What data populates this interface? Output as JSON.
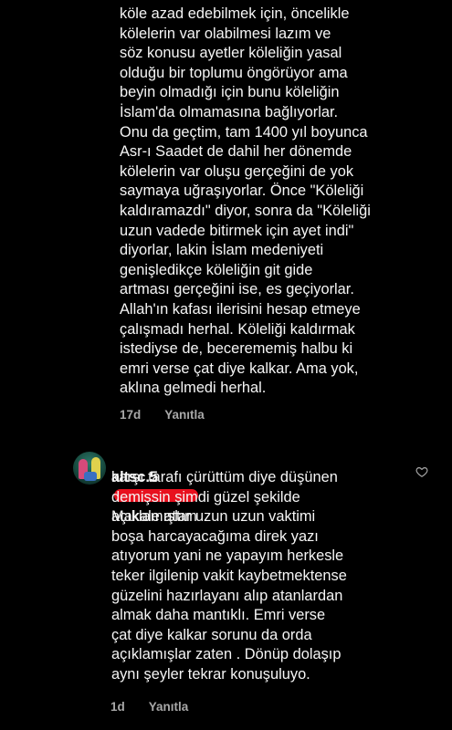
{
  "thread": {
    "first_comment": {
      "text": "köle azad edebilmek için, öncelikle\nkölelerin var olabilmesi lazım ve\nsöz konusu ayetler köleliğin yasal\nolduğu bir toplumu öngörüyor ama\nbeyin olmadığı için bunu köleliğin\nİslam'da olmamasına bağlıyorlar.\nOnu da geçtim, tam 1400 yıl boyunca\nAsr-ı Saadet de dahil her dönemde\nkölelerin var oluşu gerçeğini de yok\nsaymaya uğraşıyorlar. Önce \"Köleliği\nkaldıramazdı\" diyor, sonra da \"Köleliği\nuzun vadede bitirmek için ayet indi\"\ndiyorlar, lakin İslam medeniyeti\ngenişledikçe köleliğin git gide\nartması gerçeğini ise, es geçiyorlar.\nAllah'ın kafası ilerisini hesap etmeye\nçalışmadı herhal. Köleliği kaldırmak\nistediyse de, becerememiş halbu ki\nemri verse çat diye kalkar. Ama yok,\naklına gelmedi herhal.",
      "time": "17d",
      "reply_label": "Yanıtla"
    },
    "second_comment": {
      "username": "altsc.5",
      "text_line1": "Makale attım",
      "text": "karşı tarafı çürüttüm diye düşünen\ndemişsin şimdi güzel şekilde\naçıklamışlar uzun uzun vaktimi\nboşa harcayacağıma direk yazı\natıyorum yani ne yapayım herkesle\nteker ilgilenip vakit kaybetmektense\ngüzelini hazırlayanı alıp atanlardan\nalmak daha mantıklı. Emri verse\nçat diye kalkar sorunu da orda\naçıklamışlar zaten . Dönüp dolaşıp\naynı şeyler tekrar konuşuluyo.",
      "time": "1d",
      "reply_label": "Yanıtla",
      "like_icon": "heart-outline-icon"
    }
  },
  "colors": {
    "background": "#000000",
    "text": "#f5f5f5",
    "meta": "#a8a8a8",
    "redaction": "#e8101e"
  }
}
